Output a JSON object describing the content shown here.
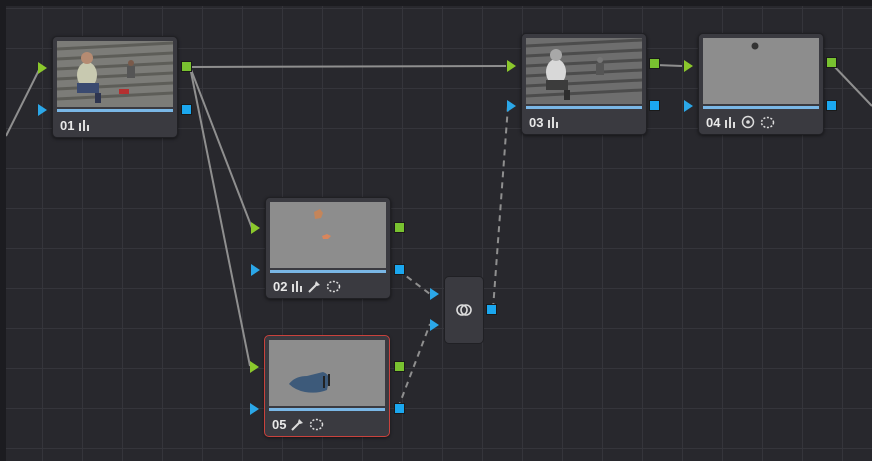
{
  "nodes": [
    {
      "id": "01",
      "label": "01",
      "tools": [
        "curves-icon"
      ],
      "selected": false
    },
    {
      "id": "02",
      "label": "02",
      "tools": [
        "curves-icon",
        "qualifier-picker-icon",
        "window-icon"
      ],
      "selected": false
    },
    {
      "id": "03",
      "label": "03",
      "tools": [
        "curves-icon"
      ],
      "selected": false
    },
    {
      "id": "04",
      "label": "04",
      "tools": [
        "curves-icon",
        "tracker-icon",
        "window-icon"
      ],
      "selected": false
    },
    {
      "id": "05",
      "label": "05",
      "tools": [
        "qualifier-picker-icon",
        "window-icon"
      ],
      "selected": true
    }
  ],
  "mixer": {
    "icon": "layer-mixer-icon"
  },
  "colors": {
    "canvas": "#28282d",
    "grid": "#35353b",
    "node": "#3a3a40",
    "rgb_input": "#8bc82c",
    "key_input": "#2ba7e8",
    "selected_border": "#c9423d",
    "link_solid": "#8f8f8f",
    "link_dashed": "#8f8f8f"
  }
}
